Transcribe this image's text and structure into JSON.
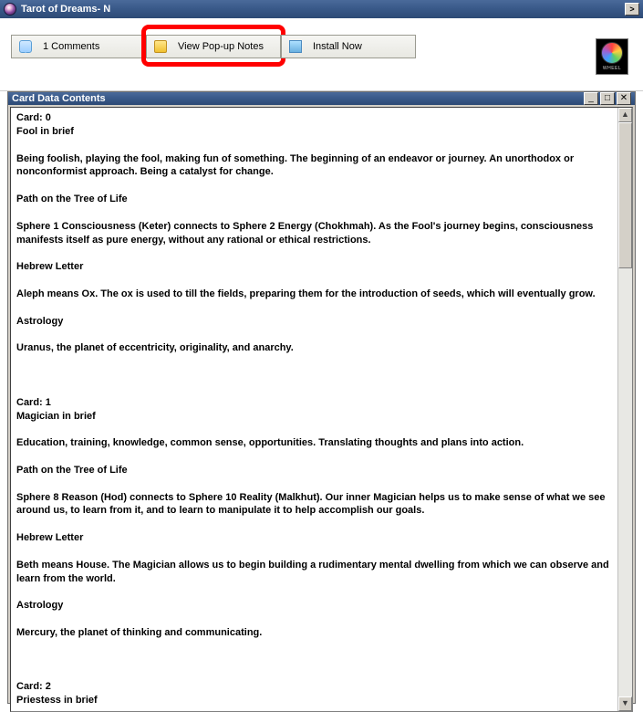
{
  "outer": {
    "title": "Tarot of Dreams- N"
  },
  "toolbar": {
    "comments": {
      "label": "1 Comments"
    },
    "popup": {
      "label": "View Pop-up Notes"
    },
    "install": {
      "label": "Install Now"
    }
  },
  "logo": {
    "label": "WHEEL"
  },
  "inner": {
    "title": "Card Data Contents"
  },
  "content": {
    "text": "Card: 0\nFool in brief\n\nBeing foolish, playing the fool, making fun of something. The beginning of an endeavor or journey. An unorthodox or nonconformist approach. Being a catalyst for change.\n\nPath on the Tree of Life\n\nSphere 1 Consciousness (Keter) connects to Sphere 2 Energy (Chokhmah). As the Fool's journey begins, consciousness manifests itself as pure energy, without any rational or ethical restrictions.\n\nHebrew Letter\n\nAleph means Ox. The ox is used to till the fields, preparing them for the introduction of seeds, which will eventually grow.\n\nAstrology\n\nUranus, the planet of eccentricity, originality, and anarchy.\n\n\n\nCard: 1\nMagician in brief\n\nEducation, training, knowledge, common sense, opportunities. Translating thoughts and plans into action.\n\nPath on the Tree of Life\n\nSphere 8 Reason (Hod) connects to Sphere 10 Reality (Malkhut). Our inner Magician helps us to make sense of what we see around us, to learn from it, and to learn to manipulate it to help accomplish our goals.\n\nHebrew Letter\n\nBeth means House. The Magician allows us to begin building a rudimentary mental dwelling from which we can observe and learn from the world.\n\nAstrology\n\nMercury, the planet of thinking and communicating.\n\n\n\nCard: 2\nPriestess in brief"
  },
  "scroll": {
    "up": "▲",
    "down": "▼"
  },
  "winbtn": {
    "min": "_",
    "max": "□",
    "close": "✕",
    "outerScroll": ">"
  }
}
